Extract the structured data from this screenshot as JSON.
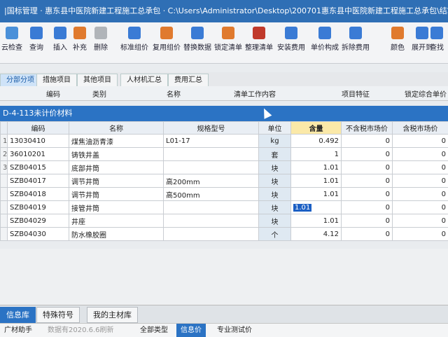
{
  "window": {
    "title": "|国标管理 · 惠东县中医院新建工程施工总承包 · C:\\Users\\Administrator\\Desktop\\200701惠东县中医院新建工程施工总承包\\结算书\\惠东县中医院新"
  },
  "toolbar": {
    "buttons": [
      {
        "label": "云检查",
        "icon": "cloud-check-icon",
        "color": "#4a90d9"
      },
      {
        "label": "查询",
        "icon": "search-icon",
        "color": "#3a7bd5"
      },
      {
        "label": "插入",
        "icon": "insert-icon",
        "color": "#3a7bd5"
      },
      {
        "label": "补充",
        "icon": "supplement-icon",
        "color": "#e07a2e"
      },
      {
        "label": "删除",
        "icon": "delete-icon",
        "color": "#b0b4b9"
      },
      {
        "label": "标准组价",
        "icon": "standard-price-icon",
        "color": "#3a7bd5"
      },
      {
        "label": "复用组价",
        "icon": "reuse-price-icon",
        "color": "#e07a2e"
      },
      {
        "label": "替换数据",
        "icon": "replace-data-icon",
        "color": "#3a7bd5"
      },
      {
        "label": "锁定清单",
        "icon": "lock-icon",
        "color": "#e07a2e"
      },
      {
        "label": "整理清单",
        "icon": "organize-icon",
        "color": "#c0392b"
      },
      {
        "label": "安装费用",
        "icon": "install-fee-icon",
        "color": "#3a7bd5"
      },
      {
        "label": "单价构成",
        "icon": "unit-price-icon",
        "color": "#3a7bd5"
      },
      {
        "label": "拆除费用",
        "icon": "demolition-fee-icon",
        "color": "#3a7bd5"
      },
      {
        "label": "颜色",
        "icon": "color-icon",
        "color": "#e07a2e"
      },
      {
        "label": "展开到",
        "icon": "expand-icon",
        "color": "#3a7bd5"
      },
      {
        "label": "查找",
        "icon": "find-icon",
        "color": "#3a7bd5"
      }
    ]
  },
  "upper_tabs": [
    {
      "label": "分部分项",
      "active": true
    },
    {
      "label": "措施项目",
      "active": false
    },
    {
      "label": "其他项目",
      "active": false
    },
    {
      "label": "人材机汇总",
      "active": false
    },
    {
      "label": "费用汇总",
      "active": false
    }
  ],
  "upper_header": [
    "编码",
    "类别",
    "名称",
    "清单工作内容",
    "项目特征",
    "锁定综合单价"
  ],
  "material_panel": {
    "title": "D-4-113未计价材料",
    "columns": [
      "编码",
      "名称",
      "规格型号",
      "单位",
      "含量",
      "不含税市场价",
      "含税市场价"
    ],
    "rows": [
      {
        "no": "1",
        "code": "13030410",
        "name": "煤焦油沥青漆",
        "spec": "L01-17",
        "unit": "kg",
        "qty": "0.492",
        "price_ex": "0",
        "price_in": "0"
      },
      {
        "no": "2",
        "code": "36010201",
        "name": "铸铁井盖",
        "spec": "",
        "unit": "套",
        "qty": "1",
        "price_ex": "0",
        "price_in": "0"
      },
      {
        "no": "3",
        "code": "SZB04015",
        "name": "底部井筒",
        "spec": "",
        "unit": "块",
        "qty": "1.01",
        "price_ex": "0",
        "price_in": "0"
      },
      {
        "no": "",
        "code": "SZB04017",
        "name": "调节井筒",
        "spec": "高200mm",
        "unit": "块",
        "qty": "1.01",
        "price_ex": "0",
        "price_in": "0"
      },
      {
        "no": "",
        "code": "SZB04018",
        "name": "调节井筒",
        "spec": "高500mm",
        "unit": "块",
        "qty": "1.01",
        "price_ex": "0",
        "price_in": "0"
      },
      {
        "no": "",
        "code": "SZB04019",
        "name": "接管井筒",
        "spec": "",
        "unit": "块",
        "qty": "1.01",
        "price_ex": "0",
        "price_in": "0",
        "selected": true
      },
      {
        "no": "",
        "code": "SZB04029",
        "name": "井座",
        "spec": "",
        "unit": "块",
        "qty": "1.01",
        "price_ex": "0",
        "price_in": "0"
      },
      {
        "no": "",
        "code": "SZB04030",
        "name": "防水橡胶圈",
        "spec": "",
        "unit": "个",
        "qty": "4.12",
        "price_ex": "0",
        "price_in": "0"
      }
    ]
  },
  "lower_tabs": [
    {
      "label": "信息库",
      "active": true
    },
    {
      "label": "特殊符号",
      "active": false
    },
    {
      "label": "我的主材库",
      "active": false
    }
  ],
  "statusbar": {
    "assistant": "广材助手",
    "data_note": "数据有2020.6.6刷新",
    "all_types": "全部类型",
    "info_price": "信息价",
    "pro_test": "专业测试价"
  }
}
